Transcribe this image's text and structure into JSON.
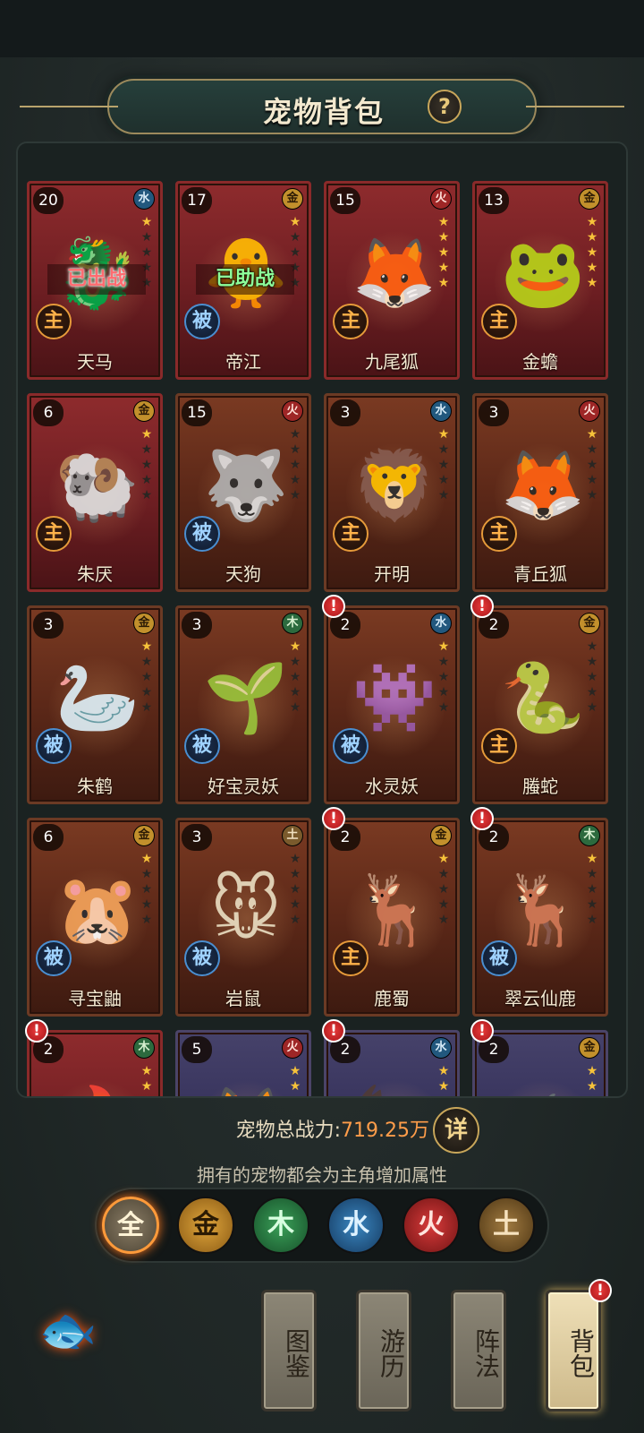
{
  "title": "宠物背包",
  "help_label": "?",
  "pets": [
    {
      "level": "20",
      "element": "水",
      "element_class": "shui",
      "stars": [
        1,
        0,
        0,
        0,
        0
      ],
      "role": "主",
      "role_class": "main",
      "status": "已出战",
      "status_class": "out",
      "name": "天马",
      "frame": "red",
      "alert": false,
      "glyph": "🐉"
    },
    {
      "level": "17",
      "element": "金",
      "element_class": "jin",
      "stars": [
        1,
        0,
        0,
        0,
        0
      ],
      "role": "被",
      "role_class": "passive",
      "status": "已助战",
      "status_class": "assist",
      "name": "帝江",
      "frame": "red",
      "alert": false,
      "glyph": "🐥"
    },
    {
      "level": "15",
      "element": "火",
      "element_class": "huo",
      "stars": [
        1,
        1,
        1,
        1,
        1
      ],
      "role": "主",
      "role_class": "main",
      "status": "",
      "status_class": "",
      "name": "九尾狐",
      "frame": "red",
      "alert": false,
      "glyph": "🦊"
    },
    {
      "level": "13",
      "element": "金",
      "element_class": "jin",
      "stars": [
        1,
        1,
        1,
        1,
        1
      ],
      "role": "主",
      "role_class": "main",
      "status": "",
      "status_class": "",
      "name": "金蟾",
      "frame": "red",
      "alert": false,
      "glyph": "🐸"
    },
    {
      "level": "6",
      "element": "金",
      "element_class": "jin",
      "stars": [
        1,
        0,
        0,
        0,
        0
      ],
      "role": "主",
      "role_class": "main",
      "status": "",
      "status_class": "",
      "name": "朱厌",
      "frame": "red",
      "alert": false,
      "glyph": "🐏"
    },
    {
      "level": "15",
      "element": "火",
      "element_class": "huo",
      "stars": [
        0,
        0,
        0,
        0,
        0
      ],
      "role": "被",
      "role_class": "passive",
      "status": "",
      "status_class": "",
      "name": "天狗",
      "frame": "brown",
      "alert": false,
      "glyph": "🐺"
    },
    {
      "level": "3",
      "element": "水",
      "element_class": "shui",
      "stars": [
        1,
        0,
        0,
        0,
        0
      ],
      "role": "主",
      "role_class": "main",
      "status": "",
      "status_class": "",
      "name": "开明",
      "frame": "brown",
      "alert": false,
      "glyph": "🦁"
    },
    {
      "level": "3",
      "element": "火",
      "element_class": "huo",
      "stars": [
        1,
        0,
        0,
        0,
        0
      ],
      "role": "主",
      "role_class": "main",
      "status": "",
      "status_class": "",
      "name": "青丘狐",
      "frame": "brown",
      "alert": false,
      "glyph": "🦊"
    },
    {
      "level": "3",
      "element": "金",
      "element_class": "jin",
      "stars": [
        1,
        0,
        0,
        0,
        0
      ],
      "role": "被",
      "role_class": "passive",
      "status": "",
      "status_class": "",
      "name": "朱鹤",
      "frame": "brown",
      "alert": false,
      "glyph": "🦢"
    },
    {
      "level": "3",
      "element": "木",
      "element_class": "mu",
      "stars": [
        1,
        0,
        0,
        0,
        0
      ],
      "role": "被",
      "role_class": "passive",
      "status": "",
      "status_class": "",
      "name": "好宝灵妖",
      "frame": "brown",
      "alert": false,
      "glyph": "🌱"
    },
    {
      "level": "2",
      "element": "水",
      "element_class": "shui",
      "stars": [
        1,
        0,
        0,
        0,
        0
      ],
      "role": "被",
      "role_class": "passive",
      "status": "",
      "status_class": "",
      "name": "水灵妖",
      "frame": "brown",
      "alert": true,
      "glyph": "👾"
    },
    {
      "level": "2",
      "element": "金",
      "element_class": "jin",
      "stars": [
        0,
        0,
        0,
        0,
        0
      ],
      "role": "主",
      "role_class": "main",
      "status": "",
      "status_class": "",
      "name": "螣蛇",
      "frame": "brown",
      "alert": true,
      "glyph": "🐍"
    },
    {
      "level": "6",
      "element": "金",
      "element_class": "jin",
      "stars": [
        1,
        0,
        0,
        0,
        0
      ],
      "role": "被",
      "role_class": "passive",
      "status": "",
      "status_class": "",
      "name": "寻宝鼬",
      "frame": "brown",
      "alert": false,
      "glyph": "🐹"
    },
    {
      "level": "3",
      "element": "土",
      "element_class": "tu",
      "stars": [
        0,
        0,
        0,
        0,
        0
      ],
      "role": "被",
      "role_class": "passive",
      "status": "",
      "status_class": "",
      "name": "岩鼠",
      "frame": "brown",
      "alert": false,
      "glyph": "🐭"
    },
    {
      "level": "2",
      "element": "金",
      "element_class": "jin",
      "stars": [
        1,
        0,
        0,
        0,
        0
      ],
      "role": "主",
      "role_class": "main",
      "status": "",
      "status_class": "",
      "name": "鹿蜀",
      "frame": "brown",
      "alert": true,
      "glyph": "🦌"
    },
    {
      "level": "2",
      "element": "木",
      "element_class": "mu",
      "stars": [
        1,
        0,
        0,
        0,
        0
      ],
      "role": "被",
      "role_class": "passive",
      "status": "",
      "status_class": "",
      "name": "翠云仙鹿",
      "frame": "brown",
      "alert": true,
      "glyph": "🦌"
    },
    {
      "level": "2",
      "element": "木",
      "element_class": "mu",
      "stars": [
        1,
        1,
        1
      ],
      "role": "",
      "role_class": "",
      "status": "",
      "status_class": "",
      "name": "",
      "frame": "red",
      "alert": true,
      "glyph": "🔥"
    },
    {
      "level": "5",
      "element": "火",
      "element_class": "huo",
      "stars": [
        1,
        1,
        1
      ],
      "role": "",
      "role_class": "",
      "status": "",
      "status_class": "",
      "name": "",
      "frame": "purple",
      "alert": false,
      "glyph": "🦊"
    },
    {
      "level": "2",
      "element": "水",
      "element_class": "shui",
      "stars": [
        1,
        1,
        1
      ],
      "role": "",
      "role_class": "",
      "status": "",
      "status_class": "",
      "name": "",
      "frame": "purple",
      "alert": true,
      "glyph": "🦅"
    },
    {
      "level": "2",
      "element": "金",
      "element_class": "jin",
      "stars": [
        1,
        1,
        1
      ],
      "role": "",
      "role_class": "",
      "status": "",
      "status_class": "",
      "name": "",
      "frame": "purple",
      "alert": true,
      "glyph": "🦋"
    }
  ],
  "power": {
    "label": "宠物总战力:",
    "value": "719.25万"
  },
  "detail_label": "详",
  "hint": "拥有的宠物都会为主角增加属性",
  "filters": {
    "all": "全",
    "jin": "金",
    "mu": "木",
    "shui": "水",
    "huo": "火",
    "tu": "土"
  },
  "nav": {
    "tujian": "图鉴",
    "youli": "游历",
    "zhenfa": "阵法",
    "beibao": "背包"
  },
  "alert_label": "!",
  "fish_glyph": "🐟"
}
